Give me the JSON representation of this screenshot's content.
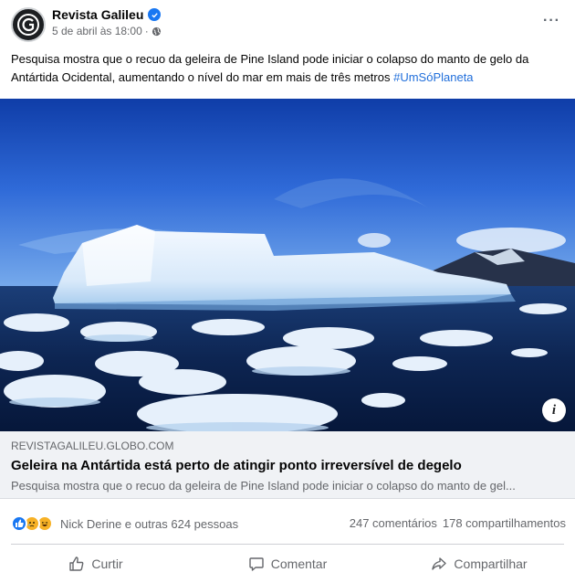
{
  "post": {
    "page_name": "Revista Galileu",
    "timestamp": "5 de abril às 18:00",
    "text": "Pesquisa mostra que o recuo da geleira de Pine Island pode iniciar o colapso do manto de gelo da Antártida Ocidental, aumentando o nível do mar em mais de três metros ",
    "hashtag": "#UmSóPlaneta",
    "verified_icon": "verified-badge-icon",
    "privacy_icon": "globe-icon",
    "more_label": "···"
  },
  "link_preview": {
    "domain": "REVISTAGALILEU.GLOBO.COM",
    "title": "Geleira na Antártida está perto de atingir ponto irreversível de degelo",
    "description": "Pesquisa mostra que o recuo da geleira de Pine Island pode iniciar o colapso do manto de gel...",
    "info_label": "i"
  },
  "engagement": {
    "reaction_icons": [
      "like-icon",
      "sad-icon",
      "haha-icon"
    ],
    "reaction_names": "Nick Derine e outras 624 pessoas",
    "comments": "247 comentários",
    "shares": "178 compartilhamentos"
  },
  "actions": {
    "like_label": "Curtir",
    "comment_label": "Comentar",
    "share_label": "Compartilhar"
  },
  "colors": {
    "hashtag": "#216fdb",
    "verified": "#1877f2",
    "secondary_text": "#65676b",
    "preview_bg": "#f0f2f5"
  }
}
